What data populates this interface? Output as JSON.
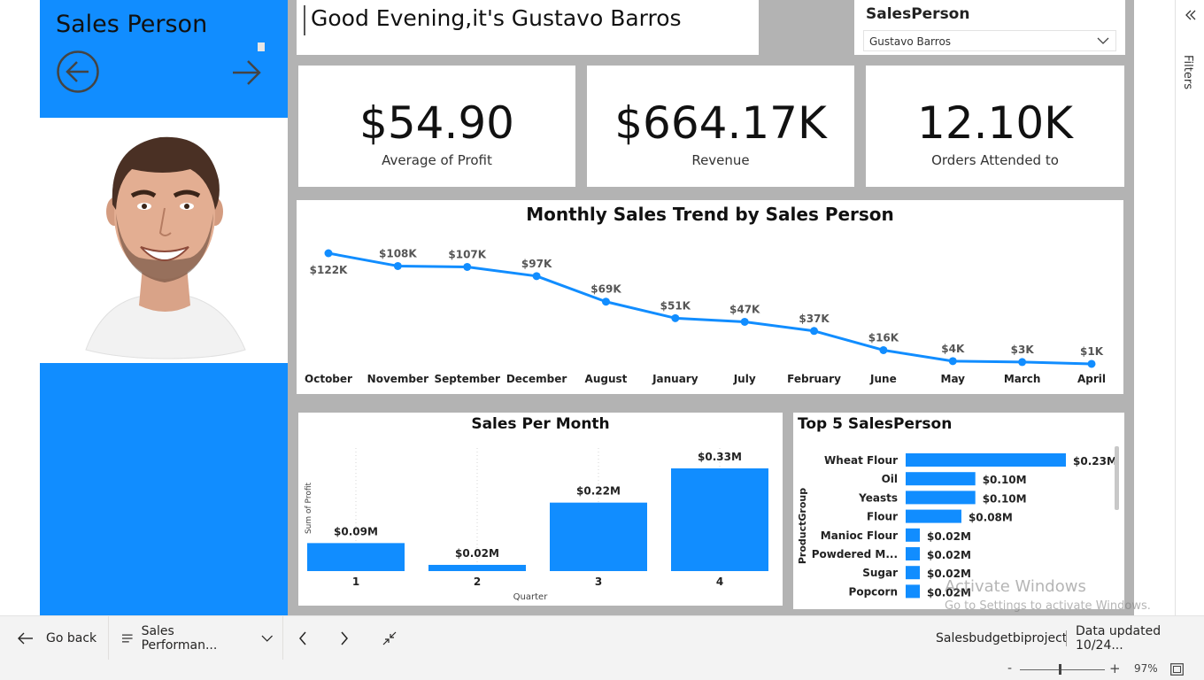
{
  "left_panel": {
    "title": "Sales Person",
    "back_icon": "arrow-left-circle-icon",
    "forward_icon": "arrow-right-icon",
    "photo": "salesperson-photo"
  },
  "greeting": "Good Evening,it's Gustavo Barros",
  "slicer": {
    "title": "SalesPerson",
    "selected": "Gustavo Barros"
  },
  "kpis": {
    "profit": {
      "value": "$54.90",
      "label": "Average of Profit"
    },
    "revenue": {
      "value": "$664.17K",
      "label": "Revenue"
    },
    "orders": {
      "value": "12.10K",
      "label": "Orders Attended to"
    }
  },
  "chart_data": [
    {
      "type": "line",
      "title": "Monthly Sales Trend by Sales Person",
      "categories": [
        "October",
        "November",
        "September",
        "December",
        "August",
        "January",
        "July",
        "February",
        "June",
        "May",
        "March",
        "April"
      ],
      "values": [
        122,
        108,
        107,
        97,
        69,
        51,
        47,
        37,
        16,
        4,
        3,
        1
      ],
      "labels": [
        "$122K",
        "$108K",
        "$107K",
        "$97K",
        "$69K",
        "$51K",
        "$47K",
        "$37K",
        "$16K",
        "$4K",
        "$3K",
        "$1K"
      ],
      "color": "#118dff"
    },
    {
      "type": "bar",
      "title": "Sales Per Month",
      "categories": [
        "1",
        "2",
        "3",
        "4"
      ],
      "values": [
        0.09,
        0.02,
        0.22,
        0.33
      ],
      "labels": [
        "$0.09M",
        "$0.02M",
        "$0.22M",
        "$0.33M"
      ],
      "xlabel": "Quarter",
      "ylabel": "Sum of Profit",
      "color": "#118dff"
    },
    {
      "type": "bar",
      "orientation": "horizontal",
      "title": "Top 5 SalesPerson",
      "ylabel": "ProductGroup",
      "categories": [
        "Wheat Flour",
        "Oil",
        "Yeasts",
        "Flour",
        "Manioc Flour",
        "Powdered M...",
        "Sugar",
        "Popcorn"
      ],
      "values": [
        0.23,
        0.1,
        0.1,
        0.08,
        0.02,
        0.02,
        0.02,
        0.02
      ],
      "labels": [
        "$0.23M",
        "$0.10M",
        "$0.10M",
        "$0.08M",
        "$0.02M",
        "$0.02M",
        "$0.02M",
        "$0.02M"
      ],
      "color": "#118dff"
    }
  ],
  "filters": {
    "label": "Filters",
    "collapse_icon": "double-chevron-left-icon"
  },
  "watermark": {
    "title": "Activate Windows",
    "subtitle": "Go to Settings to activate Windows."
  },
  "bottom_bar": {
    "go_back": "Go back",
    "page": "Sales Performan...",
    "workspace": "Salesbudgetbiproject",
    "data_updated": "Data updated 10/24..."
  },
  "status_bar": {
    "zoom_minus": "-",
    "zoom_plus": "+",
    "zoom": "97%"
  }
}
